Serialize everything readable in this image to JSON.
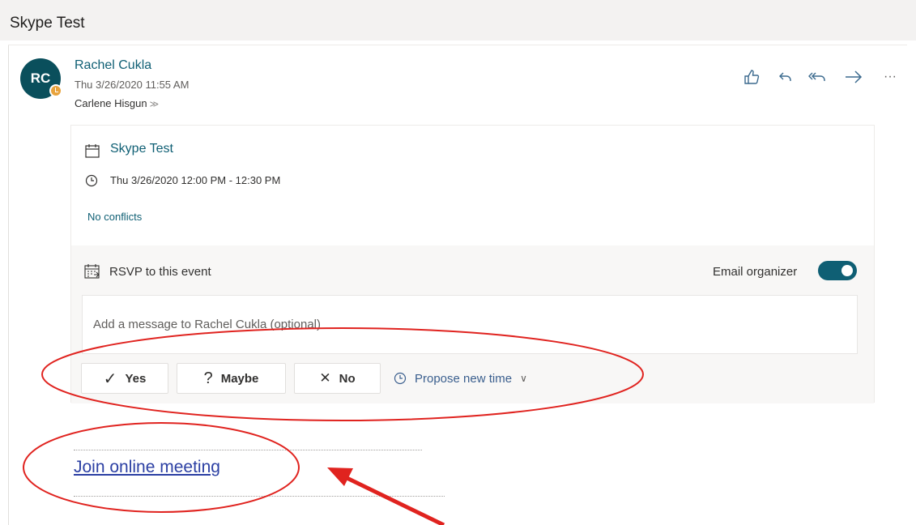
{
  "subject": "Skype Test",
  "message": {
    "avatar_initials": "RC",
    "sender": "Rachel Cukla",
    "date": "Thu 3/26/2020 11:55 AM",
    "recipient": "Carlene Hisgun"
  },
  "actions": {
    "icons": [
      "like-icon",
      "reply-icon",
      "reply-all-icon",
      "forward-icon",
      "more-icon"
    ],
    "more_label": "···"
  },
  "event": {
    "title": "Skype Test",
    "time": "Thu 3/26/2020 12:00 PM - 12:30 PM",
    "conflicts": "No conflicts"
  },
  "rsvp": {
    "title": "RSVP to this event",
    "email_organizer_label": "Email organizer",
    "email_organizer_on": true,
    "message_placeholder": "Add a message to Rachel Cukla (optional)",
    "buttons": {
      "yes": "Yes",
      "maybe": "Maybe",
      "no": "No",
      "propose": "Propose new time"
    },
    "icons": {
      "yes": "✓",
      "maybe": "?",
      "no": "✕",
      "chevron": "∨"
    }
  },
  "join_link": "Join online meeting",
  "colors": {
    "accent": "#0f5f74",
    "link": "#2b3fa3",
    "annotation": "#e0231f"
  }
}
